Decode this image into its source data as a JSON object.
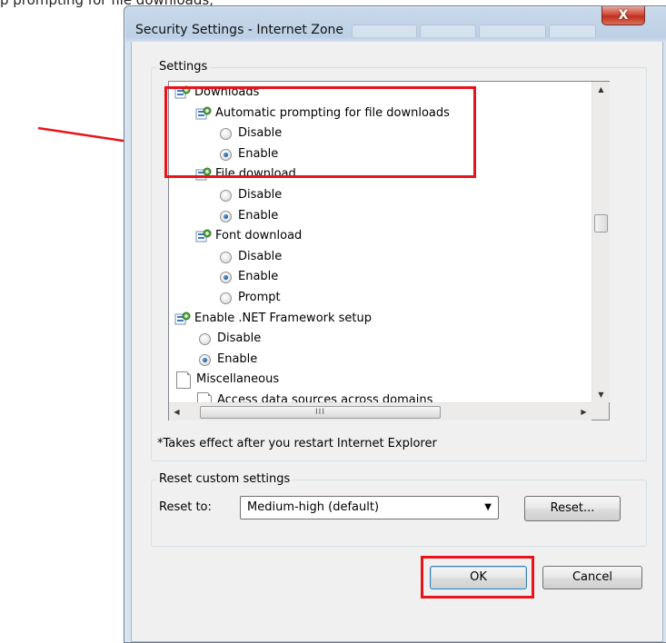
{
  "top_fragment": "p prompting  for file downloads, ",
  "window": {
    "title": "Security Settings - Internet Zone",
    "close_glyph": "X"
  },
  "settings": {
    "group_label": "Settings",
    "rows": [
      {
        "kind": "category",
        "indent": 0,
        "icon": "setting-icon",
        "label": "Downloads"
      },
      {
        "kind": "setting",
        "indent": 1,
        "icon": "setting-icon",
        "label": "Automatic prompting for file downloads"
      },
      {
        "kind": "option",
        "indent": 2,
        "checked": false,
        "label": "Disable"
      },
      {
        "kind": "option",
        "indent": 2,
        "checked": true,
        "label": "Enable"
      },
      {
        "kind": "setting",
        "indent": 1,
        "icon": "setting-icon",
        "label": "File download"
      },
      {
        "kind": "option",
        "indent": 2,
        "checked": false,
        "label": "Disable"
      },
      {
        "kind": "option",
        "indent": 2,
        "checked": true,
        "label": "Enable"
      },
      {
        "kind": "setting",
        "indent": 1,
        "icon": "setting-icon",
        "label": "Font download"
      },
      {
        "kind": "option",
        "indent": 2,
        "checked": false,
        "label": "Disable"
      },
      {
        "kind": "option",
        "indent": 2,
        "checked": true,
        "label": "Enable"
      },
      {
        "kind": "option",
        "indent": 2,
        "checked": false,
        "label": "Prompt"
      },
      {
        "kind": "setting",
        "indent": 0,
        "icon": "setting-icon",
        "label": "Enable .NET Framework setup"
      },
      {
        "kind": "option",
        "indent": 1,
        "checked": false,
        "label": "Disable"
      },
      {
        "kind": "option",
        "indent": 1,
        "checked": true,
        "label": "Enable"
      },
      {
        "kind": "category",
        "indent": 0,
        "icon": "page-icon",
        "label": "Miscellaneous"
      },
      {
        "kind": "setting",
        "indent": 1,
        "icon": "page-icon",
        "label": "Access data sources across domains"
      }
    ],
    "vscroll_up": "▲",
    "vscroll_down": "▼",
    "hscroll_left": "◀",
    "hscroll_right": "▶",
    "hscroll_grip": "III",
    "restart_note": "*Takes effect after you restart Internet Explorer"
  },
  "reset": {
    "group_label": "Reset custom settings",
    "reset_to_label": "Reset to:",
    "selected": "Medium-high (default)",
    "dropdown_arrow": "▼",
    "reset_button": "Reset..."
  },
  "buttons": {
    "ok": "OK",
    "cancel": "Cancel"
  },
  "annotation_colors": {
    "highlight": "#e8141a"
  }
}
